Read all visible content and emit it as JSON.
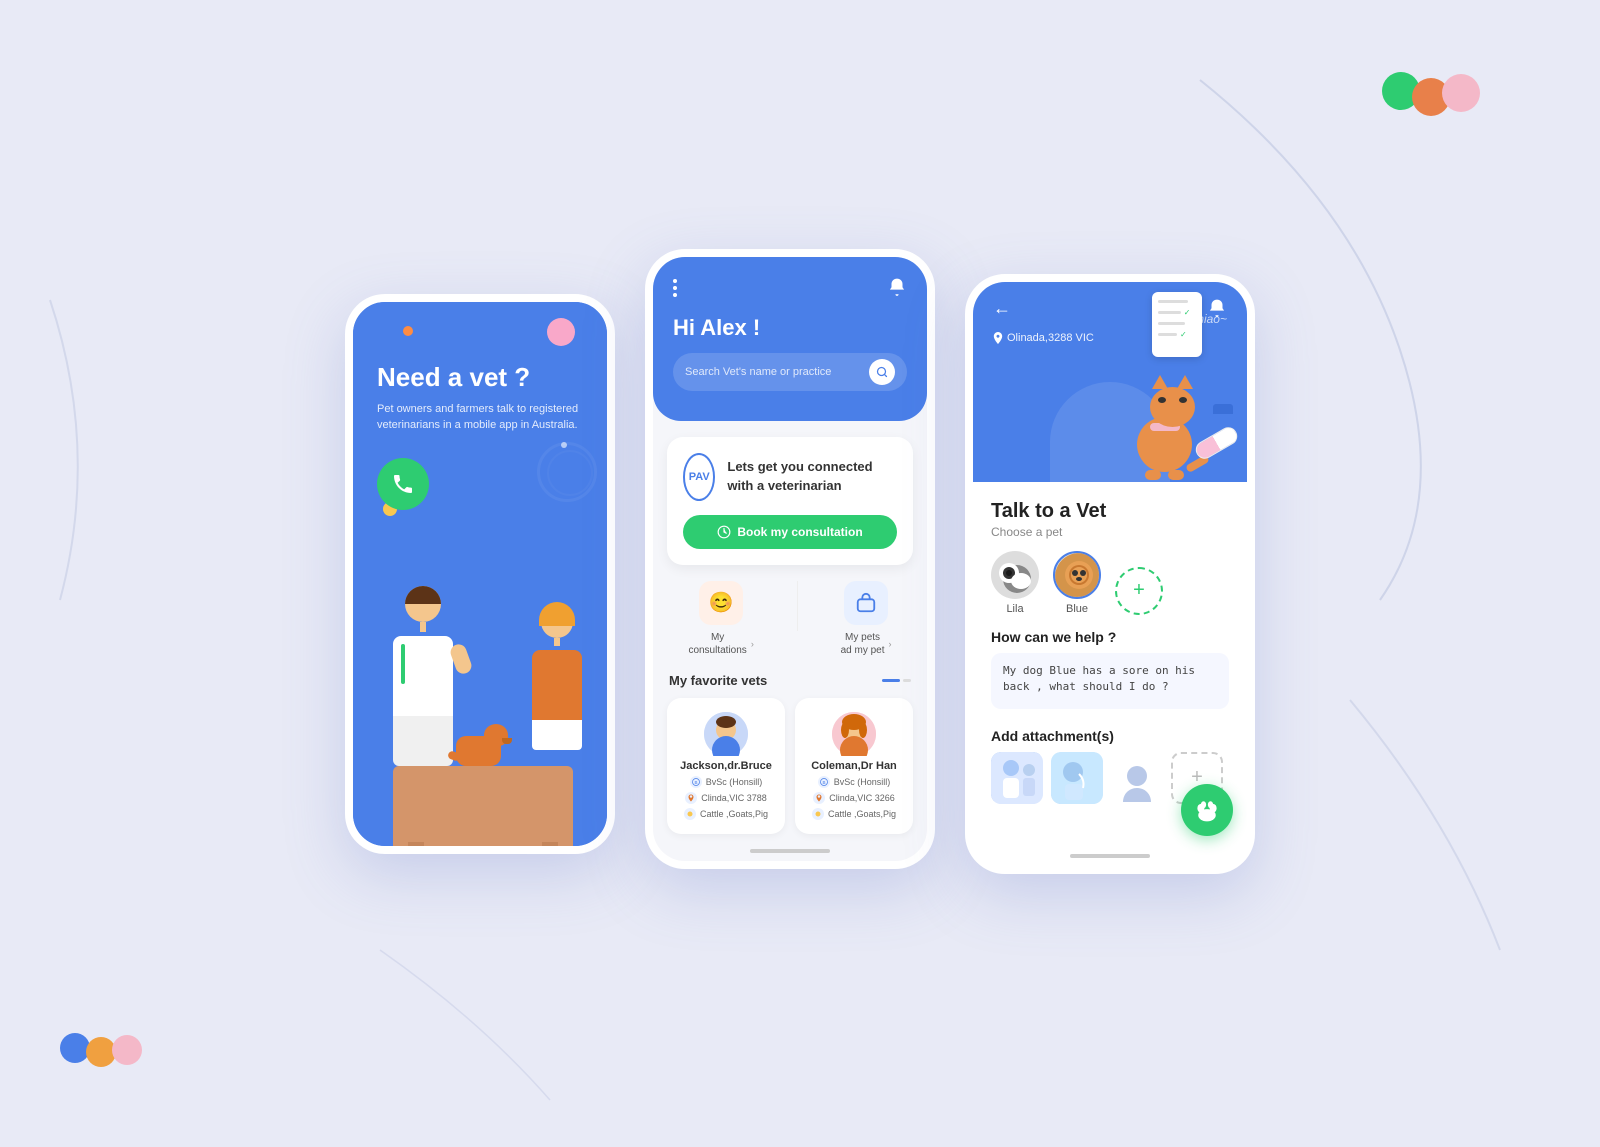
{
  "background": {
    "color": "#e8eaf6"
  },
  "color_dots_top": [
    {
      "color": "#2ecc71",
      "label": "green-dot"
    },
    {
      "color": "#e8804a",
      "label": "orange-dot"
    },
    {
      "color": "#f4b8c8",
      "label": "pink-dot"
    }
  ],
  "color_dots_bottom": [
    {
      "color": "#4a7fe8",
      "label": "blue-dot"
    },
    {
      "color": "#f0a040",
      "label": "orange-dot-sm"
    },
    {
      "color": "#f4b8c8",
      "label": "pink-dot-sm"
    }
  ],
  "phone1": {
    "title": "Need a vet ?",
    "subtitle": "Pet owners and farmers talk to registered\nveterinarians in a mobile app in Australia.",
    "call_btn_label": "call"
  },
  "phone2": {
    "menu_dots": "⋮",
    "bell_label": "notifications",
    "greeting": "Hi Alex !",
    "search_placeholder": "Search Vet's name or practice",
    "pav_logo": "PAV",
    "pav_tagline": "Lets get you connected\nwith a veterinarian",
    "book_btn": "Book my consultation",
    "quick_actions": [
      {
        "label": "My\nconsultations",
        "icon": "😊"
      },
      {
        "label": "My pets\nad my pet",
        "icon": "🏠"
      }
    ],
    "section_title": "My favorite vets",
    "vets": [
      {
        "name": "Jackson,dr.Bruce",
        "degree": "BvSc  (Honsill)",
        "location": "Clinda,VIC 3788",
        "specialty": "Cattle ,Goats,Pig",
        "gender": "male"
      },
      {
        "name": "Coleman,Dr Han",
        "degree": "BvSc  (Honsill)",
        "location": "Clinda,VIC 3266",
        "specialty": "Cattle ,Goats,Pig",
        "gender": "female"
      }
    ]
  },
  "phone3": {
    "location": "Olinada,3288 VIC",
    "miao": "miao~",
    "title": "Talk to a Vet",
    "choose_pet_label": "Choose a pet",
    "pets": [
      {
        "name": "Lila",
        "type": "cat"
      },
      {
        "name": "Blue",
        "type": "dog"
      }
    ],
    "add_pet_label": "+",
    "how_help_title": "How can we help ?",
    "help_text": "My dog Blue has a sore on his back , what should I do ?",
    "attachments_title": "Add attachment(s)",
    "add_attachment_label": "+"
  }
}
